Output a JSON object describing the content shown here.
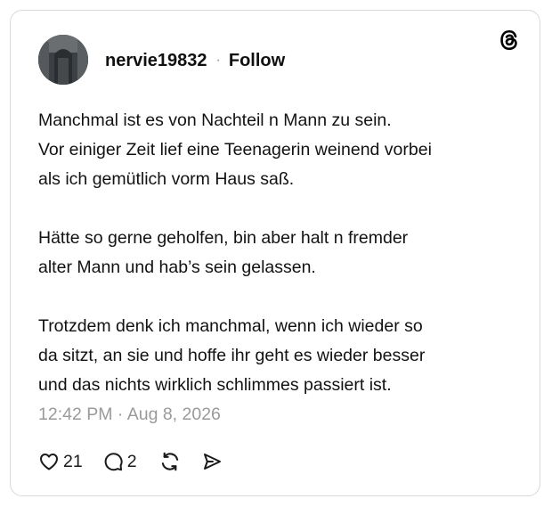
{
  "post": {
    "username": "nervie19832",
    "separator": "·",
    "follow_label": "Follow",
    "body": {
      "p1": [
        "Manchmal ist es von Nachteil n Mann zu sein.",
        "Vor einiger Zeit lief eine Teenagerin weinend vorbei",
        "als ich gemütlich vorm Haus saß."
      ],
      "p2": [
        "Hätte so gerne geholfen, bin aber halt n fremder",
        "alter Mann und hab’s sein gelassen."
      ],
      "p3": [
        "Trotzdem denk ich manchmal, wenn ich wieder so",
        "da sitzt, an sie und hoffe ihr geht es wieder besser",
        "und das nichts wirklich schlimmes passiert ist."
      ]
    },
    "timestamp": "12:42 PM · Aug 8, 2026",
    "likes": "21",
    "replies": "2"
  },
  "icons": {
    "brand": "threads-logo-icon",
    "like": "heart-icon",
    "reply": "speech-bubble-icon",
    "repost": "repost-icon",
    "share": "send-icon"
  },
  "colors": {
    "text": "#121212",
    "muted": "#9a9a9a",
    "border": "#d9d9d9"
  }
}
